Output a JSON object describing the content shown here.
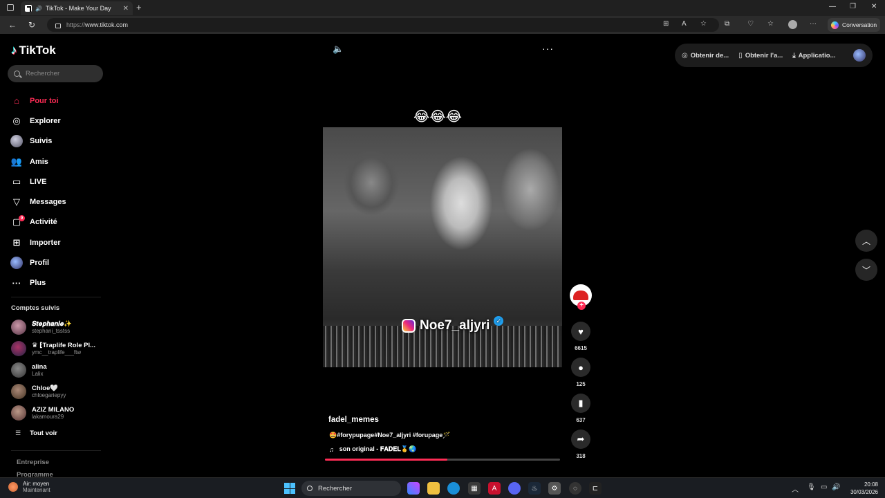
{
  "browser": {
    "tab_title": "TikTok - Make Your Day",
    "url_proto": "https://",
    "url_host": "www.tiktok.com",
    "copilot_label": "Conversation"
  },
  "sidebar": {
    "logo_text": "TikTok",
    "search_placeholder": "Rechercher",
    "nav": [
      {
        "label": "Pour toi",
        "icon": "home-icon",
        "active": true
      },
      {
        "label": "Explorer",
        "icon": "compass-icon"
      },
      {
        "label": "Suivis",
        "icon": "following-avatar-icon"
      },
      {
        "label": "Amis",
        "icon": "friends-icon"
      },
      {
        "label": "LIVE",
        "icon": "live-icon"
      },
      {
        "label": "Messages",
        "icon": "messages-icon"
      },
      {
        "label": "Activité",
        "icon": "activity-icon",
        "badge": "9"
      },
      {
        "label": "Importer",
        "icon": "upload-icon"
      },
      {
        "label": "Profil",
        "icon": "profile-avatar-icon"
      },
      {
        "label": "Plus",
        "icon": "more-dots-icon"
      }
    ],
    "following_title": "Comptes suivis",
    "following": [
      {
        "name": "𝑺𝒕𝒆𝒑𝒉𝒂𝒏𝒊𝒆✨",
        "handle": "stephani_tsstss"
      },
      {
        "name": "♛ ⁅Traplife Role Pl...",
        "handle": "ymc__traplife___ftw"
      },
      {
        "name": "alina",
        "handle": "Lalix"
      },
      {
        "name": "Chloe🤍",
        "handle": "chloegariepyy"
      },
      {
        "name": "AZIZ MILANO",
        "handle": "lakamoura29"
      }
    ],
    "see_all": "Tout voir",
    "footer_1": "Entreprise",
    "footer_2": "Programme"
  },
  "topbar": {
    "item_1": "Obtenir de...",
    "item_2": "Obtenir l'a...",
    "item_3": "Applicatio..."
  },
  "video": {
    "emoji_caption": "😂😂😂",
    "overlay_handle": "Noe7_aljyri",
    "author": "fadel_memes",
    "caption": "🤩#forypupage#Noe7_aljyri #forupage🪄",
    "music": "son original - 𝐅𝐀𝐃𝐄𝐋🥇🌏",
    "progress": 0.52
  },
  "actions": {
    "likes": "6615",
    "comments": "125",
    "saves": "637",
    "shares": "318"
  },
  "taskbar": {
    "weather_line1": "Air: moyen",
    "weather_line2": "Maintenant",
    "search_placeholder": "Rechercher",
    "time": "20:08",
    "date": "30/03/2026"
  }
}
